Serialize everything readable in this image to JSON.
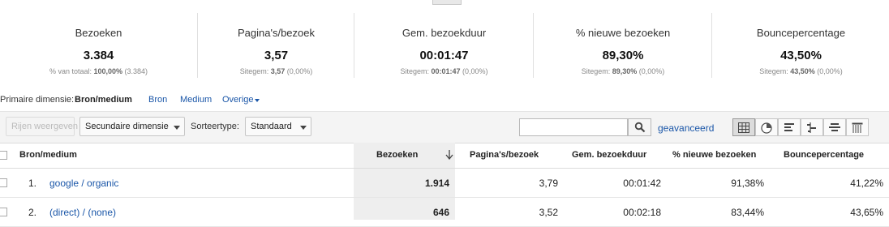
{
  "scorecards": [
    {
      "title": "Bezoeken",
      "value": "3.384",
      "sub_prefix": "% van totaal: ",
      "sub_bold": "100,00%",
      "sub_suffix": " (3.384)"
    },
    {
      "title": "Pagina's/bezoek",
      "value": "3,57",
      "sub_prefix": "Sitegem: ",
      "sub_bold": "3,57",
      "sub_suffix": " (0,00%)"
    },
    {
      "title": "Gem. bezoekduur",
      "value": "00:01:47",
      "sub_prefix": "Sitegem: ",
      "sub_bold": "00:01:47",
      "sub_suffix": " (0,00%)"
    },
    {
      "title": "% nieuwe bezoeken",
      "value": "89,30%",
      "sub_prefix": "Sitegem: ",
      "sub_bold": "89,30%",
      "sub_suffix": " (0,00%)"
    },
    {
      "title": "Bouncepercentage",
      "value": "43,50%",
      "sub_prefix": "Sitegem: ",
      "sub_bold": "43,50%",
      "sub_suffix": " (0,00%)"
    }
  ],
  "dimension": {
    "label": "Primaire dimensie:",
    "active": "Bron/medium",
    "options": [
      "Bron",
      "Medium",
      "Overige"
    ]
  },
  "toolbar": {
    "rows_button": "Rijen weergeven",
    "secondary_dimension": "Secundaire dimensie",
    "sort_label": "Sorteertype:",
    "sort_value": "Standaard",
    "search_placeholder": "",
    "advanced_link": "geavanceerd"
  },
  "table": {
    "headers": [
      "Bron/medium",
      "Bezoeken",
      "Pagina's/bezoek",
      "Gem. bezoekduur",
      "% nieuwe bezoeken",
      "Bouncepercentage"
    ],
    "rows": [
      {
        "index": "1.",
        "source": "google / organic",
        "visits": "1.914",
        "pages": "3,79",
        "duration": "00:01:42",
        "new_visits": "91,38%",
        "bounce": "41,22%"
      },
      {
        "index": "2.",
        "source": "(direct) / (none)",
        "visits": "646",
        "pages": "3,52",
        "duration": "00:02:18",
        "new_visits": "83,44%",
        "bounce": "43,65%"
      }
    ]
  },
  "colors": {
    "link": "#1a56a8",
    "sorted_column_bg": "#eeeeee"
  }
}
